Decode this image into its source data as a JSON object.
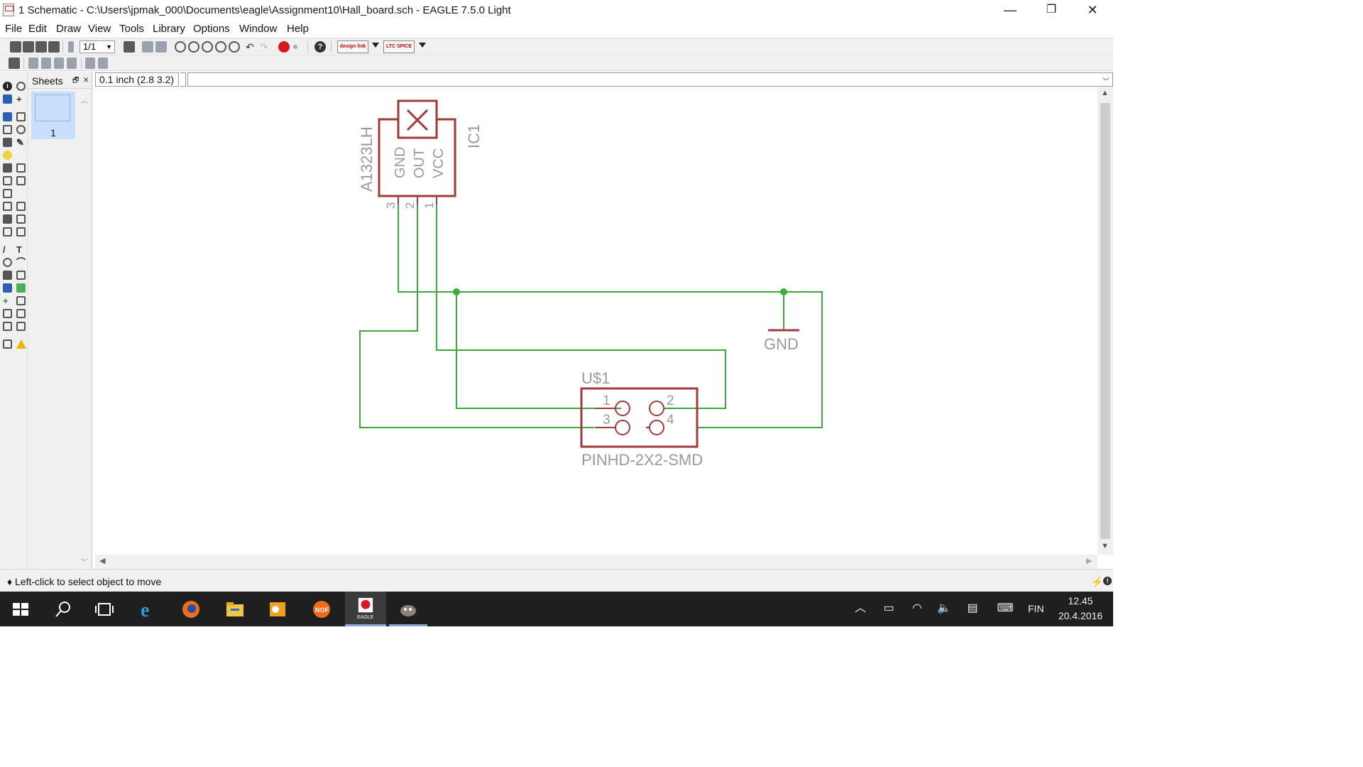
{
  "window": {
    "title": "1 Schematic - C:\\Users\\jpmak_000\\Documents\\eagle\\Assignment10\\Hall_board.sch - EAGLE 7.5.0 Light",
    "minimize_glyph": "—",
    "restore_glyph": "❐",
    "close_glyph": "✕"
  },
  "menu": {
    "file": "File",
    "edit": "Edit",
    "draw": "Draw",
    "view": "View",
    "tools": "Tools",
    "library": "Library",
    "options": "Options",
    "window": "Window",
    "help": "Help"
  },
  "toolbar": {
    "sheet_select_value": "1/1",
    "designlink_label": "design link",
    "ltspice_label": "LTC SPICE",
    "help_glyph": "?"
  },
  "sheets_panel": {
    "title": "Sheets",
    "pin_glyph": "🗗",
    "close_glyph": "×",
    "sheet_label": "1",
    "scroll_up": "︿",
    "scroll_down": "﹀"
  },
  "command_bar": {
    "coordinate": "0.1 inch (2.8 3.2)",
    "command_value": ""
  },
  "schematic": {
    "ic_name": "IC1",
    "ic_value": "A1323LH",
    "pin_gnd": "GND",
    "pin_out": "OUT",
    "pin_vcc": "VCC",
    "pin_num_3": "3",
    "pin_num_2": "2",
    "pin_num_1": "1",
    "gnd_label": "GND",
    "header_name": "U$1",
    "header_value": "PINHD-2X2-SMD",
    "header_pin_1": "1",
    "header_pin_2": "2",
    "header_pin_3": "3",
    "header_pin_4": "4",
    "colors": {
      "part": "#a13a3a",
      "net": "#3cab3c",
      "label": "#9a9a9a"
    }
  },
  "scrollbars": {
    "up": "▲",
    "down": "▼",
    "left": "◀",
    "right": "▶"
  },
  "status": {
    "text": "♦ Left-click to select object to move",
    "icon_a": "⚡",
    "icon_b": "!"
  },
  "taskbar": {
    "apps": [
      "start-icon",
      "search-icon",
      "task-view-icon",
      "internet-explorer-icon",
      "firefox-icon",
      "file-explorer-icon",
      "outlook-icon",
      "nero-icon",
      "eagle-icon",
      "gimp-icon"
    ],
    "eagle_label": "EAGLE",
    "language": "FIN",
    "time": "12.45",
    "date": "20.4.2016"
  }
}
